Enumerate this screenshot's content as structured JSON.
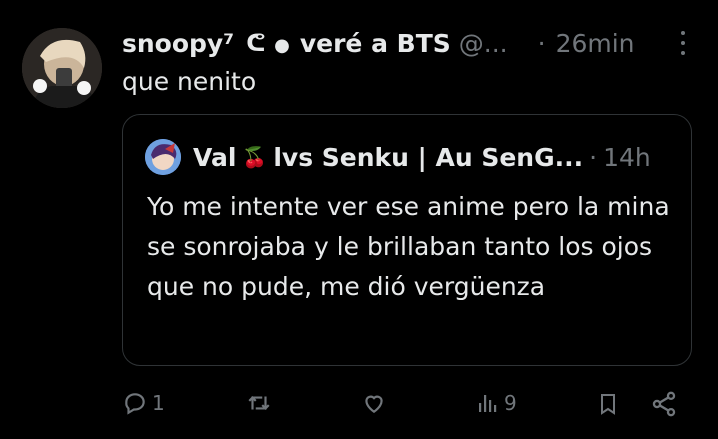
{
  "tweet": {
    "display_name": "snoopy⁷",
    "deco_text": "veré a BTS",
    "handle": "@...",
    "separator": "·",
    "time": "26min",
    "text": "que nenito"
  },
  "quote": {
    "display_name": "Val",
    "emoji": "🍒",
    "display_name_suffix": "lvs Senku | Au SenG...",
    "separator": "·",
    "time": "14h",
    "text": "Yo me intente ver ese anime pero la mina se sonrojaba y le brillaban tanto los ojos que no pude, me dió vergüenza"
  },
  "actions": {
    "reply_count": "1",
    "views_count": "9"
  },
  "icons": [
    "more-icon",
    "reply-icon",
    "retweet-icon",
    "like-icon",
    "views-icon",
    "bookmark-icon",
    "share-icon"
  ],
  "colors": {
    "background": "#000000",
    "text": "#e7e9ea",
    "muted": "#71767b",
    "border": "#2f3336"
  }
}
